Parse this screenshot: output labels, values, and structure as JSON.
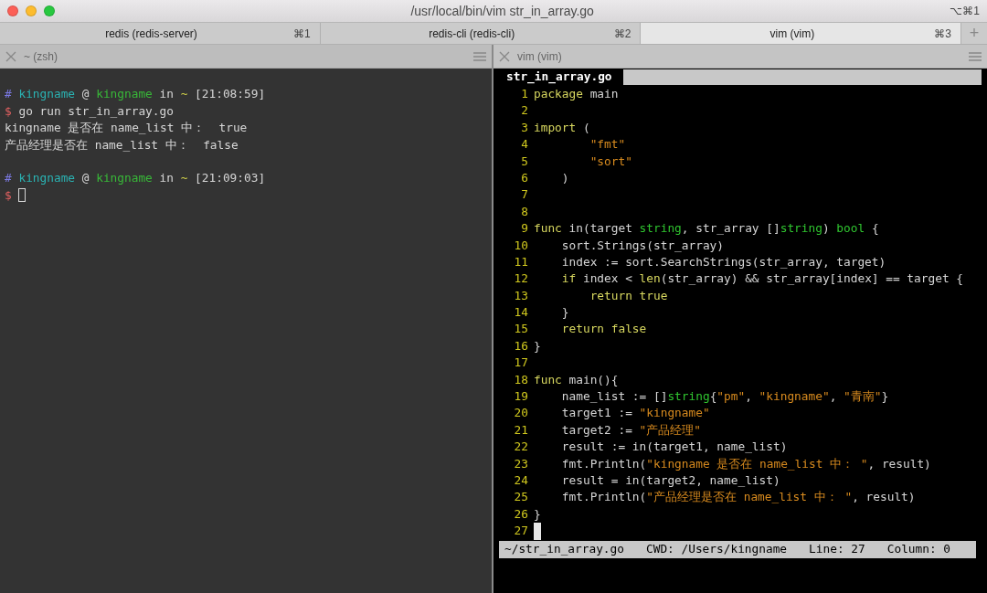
{
  "window": {
    "title": "/usr/local/bin/vim str_in_array.go",
    "shortcut": "⌥⌘1"
  },
  "tabs": [
    {
      "label": "redis (redis-server)",
      "shortcut": "⌘1",
      "selected": false
    },
    {
      "label": "redis-cli (redis-cli)",
      "shortcut": "⌘2",
      "selected": false
    },
    {
      "label": "vim (vim)",
      "shortcut": "⌘3",
      "selected": true
    }
  ],
  "new_tab": "+",
  "panes": [
    {
      "title": "~ (zsh)",
      "kind": "terminal",
      "lines": [
        {
          "kind": "blank"
        },
        {
          "kind": "text",
          "segments": [
            {
              "kind": "hash",
              "text": "# "
            },
            {
              "kind": "user",
              "text": "kingname"
            },
            {
              "kind": "plain",
              "text": " @ "
            },
            {
              "kind": "host",
              "text": "kingname"
            },
            {
              "kind": "plain",
              "text": " in "
            },
            {
              "kind": "tilde",
              "text": "~"
            },
            {
              "kind": "plain",
              "text": " [21:08:59]"
            }
          ]
        },
        {
          "kind": "text",
          "segments": [
            {
              "kind": "prompt",
              "text": "$"
            },
            {
              "kind": "plain",
              "text": " go run str_in_array.go"
            }
          ]
        },
        {
          "kind": "text",
          "segments": [
            {
              "kind": "plain",
              "text": "kingname 是否在 name_list 中：  true"
            }
          ]
        },
        {
          "kind": "text",
          "segments": [
            {
              "kind": "plain",
              "text": "产品经理是否在 name_list 中：  false"
            }
          ]
        },
        {
          "kind": "blank"
        },
        {
          "kind": "text",
          "segments": [
            {
              "kind": "hash",
              "text": "# "
            },
            {
              "kind": "user",
              "text": "kingname"
            },
            {
              "kind": "plain",
              "text": " @ "
            },
            {
              "kind": "host",
              "text": "kingname"
            },
            {
              "kind": "plain",
              "text": " in "
            },
            {
              "kind": "tilde",
              "text": "~"
            },
            {
              "kind": "plain",
              "text": " [21:09:03]"
            }
          ]
        },
        {
          "kind": "text",
          "segments": [
            {
              "kind": "prompt",
              "text": "$"
            }
          ],
          "cursor": true
        }
      ]
    },
    {
      "title": "vim (vim)",
      "kind": "editor",
      "buffer_tab": {
        "label": "str_in_array.go",
        "selected": true
      },
      "lines": [
        {
          "n": "1",
          "tokens": [
            {
              "kind": "kw",
              "text": "package"
            },
            {
              "kind": "plain",
              "text": " main"
            }
          ]
        },
        {
          "n": "2"
        },
        {
          "n": "3",
          "tokens": [
            {
              "kind": "kw",
              "text": "import"
            },
            {
              "kind": "plain",
              "text": " ("
            }
          ]
        },
        {
          "n": "4",
          "tokens": [
            {
              "kind": "str",
              "text": "        \"fmt\""
            }
          ]
        },
        {
          "n": "5",
          "tokens": [
            {
              "kind": "str",
              "text": "        \"sort\""
            }
          ]
        },
        {
          "n": "6",
          "tokens": [
            {
              "kind": "plain",
              "text": "    )"
            }
          ]
        },
        {
          "n": "7"
        },
        {
          "n": "8"
        },
        {
          "n": "9",
          "tokens": [
            {
              "kind": "kw",
              "text": "func"
            },
            {
              "kind": "plain",
              "text": " in(target "
            },
            {
              "kind": "type",
              "text": "string"
            },
            {
              "kind": "plain",
              "text": ", str_array []"
            },
            {
              "kind": "type",
              "text": "string"
            },
            {
              "kind": "plain",
              "text": ") "
            },
            {
              "kind": "type",
              "text": "bool"
            },
            {
              "kind": "plain",
              "text": " {"
            }
          ]
        },
        {
          "n": "10",
          "tokens": [
            {
              "kind": "plain",
              "text": "    sort.Strings(str_array)"
            }
          ]
        },
        {
          "n": "11",
          "tokens": [
            {
              "kind": "plain",
              "text": "    index := sort.SearchStrings(str_array, target)"
            }
          ]
        },
        {
          "n": "12",
          "tokens": [
            {
              "kind": "kw",
              "text": "    if"
            },
            {
              "kind": "plain",
              "text": " index < "
            },
            {
              "kind": "kw",
              "text": "len"
            },
            {
              "kind": "plain",
              "text": "(str_array) && str_array[index] == target {"
            }
          ]
        },
        {
          "n": "13",
          "tokens": [
            {
              "kind": "kw",
              "text": "        return true"
            }
          ]
        },
        {
          "n": "14",
          "tokens": [
            {
              "kind": "plain",
              "text": "    }"
            }
          ]
        },
        {
          "n": "15",
          "tokens": [
            {
              "kind": "kw",
              "text": "    return false"
            }
          ]
        },
        {
          "n": "16",
          "tokens": [
            {
              "kind": "plain",
              "text": "}"
            }
          ]
        },
        {
          "n": "17"
        },
        {
          "n": "18",
          "tokens": [
            {
              "kind": "kw",
              "text": "func"
            },
            {
              "kind": "plain",
              "text": " main(){"
            }
          ]
        },
        {
          "n": "19",
          "tokens": [
            {
              "kind": "plain",
              "text": "    name_list := []"
            },
            {
              "kind": "type",
              "text": "string"
            },
            {
              "kind": "plain",
              "text": "{"
            },
            {
              "kind": "str",
              "text": "\"pm\""
            },
            {
              "kind": "plain",
              "text": ", "
            },
            {
              "kind": "str",
              "text": "\"kingname\""
            },
            {
              "kind": "plain",
              "text": ", "
            },
            {
              "kind": "str",
              "text": "\"青南\""
            },
            {
              "kind": "plain",
              "text": "}"
            }
          ]
        },
        {
          "n": "20",
          "tokens": [
            {
              "kind": "plain",
              "text": "    target1 := "
            },
            {
              "kind": "str",
              "text": "\"kingname\""
            }
          ]
        },
        {
          "n": "21",
          "tokens": [
            {
              "kind": "plain",
              "text": "    target2 := "
            },
            {
              "kind": "str",
              "text": "\"产品经理\""
            }
          ]
        },
        {
          "n": "22",
          "tokens": [
            {
              "kind": "plain",
              "text": "    result := in(target1, name_list)"
            }
          ]
        },
        {
          "n": "23",
          "tokens": [
            {
              "kind": "plain",
              "text": "    fmt.Println("
            },
            {
              "kind": "str",
              "text": "\"kingname 是否在 name_list 中： \""
            },
            {
              "kind": "plain",
              "text": ", result)"
            }
          ]
        },
        {
          "n": "24",
          "tokens": [
            {
              "kind": "plain",
              "text": "    result = in(target2, name_list)"
            }
          ]
        },
        {
          "n": "25",
          "tokens": [
            {
              "kind": "plain",
              "text": "    fmt.Println("
            },
            {
              "kind": "str",
              "text": "\"产品经理是否在 name_list 中： \""
            },
            {
              "kind": "plain",
              "text": ", result)"
            }
          ]
        },
        {
          "n": "26",
          "tokens": [
            {
              "kind": "plain",
              "text": "}"
            }
          ]
        },
        {
          "n": "27",
          "cursor": true
        }
      ],
      "status_line": [
        "~/str_in_array.go",
        "CWD: /Users/kingname",
        "Line: 27",
        "Column: 0"
      ]
    }
  ]
}
